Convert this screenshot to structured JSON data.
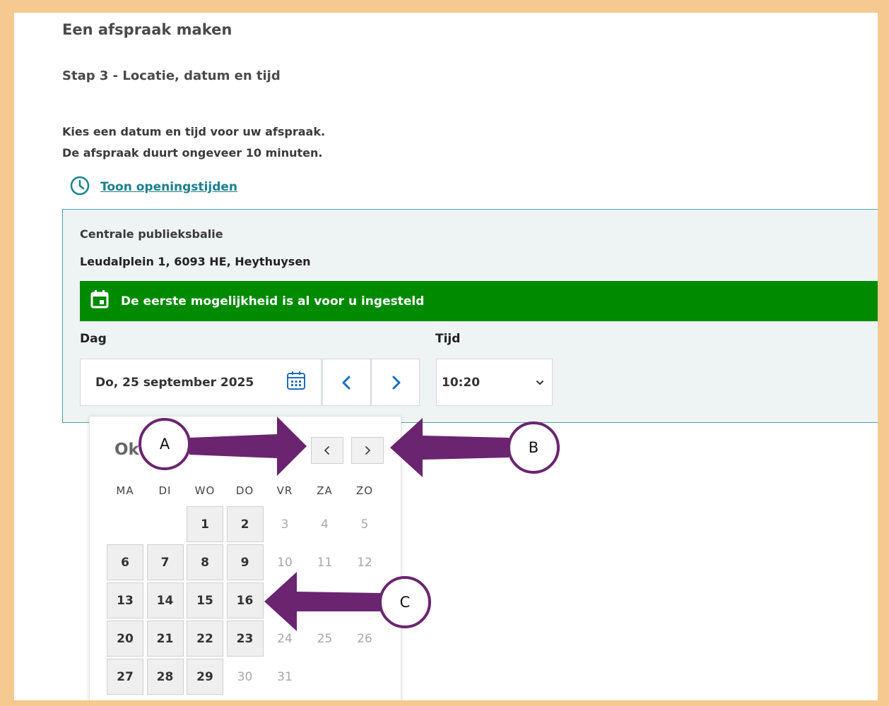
{
  "page": {
    "title": "Een afspraak maken",
    "step": "Stap 3 - Locatie, datum en tijd",
    "intro_line1": "Kies een datum en tijd voor uw afspraak.",
    "intro_line2": "De afspraak duurt ongeveer 10 minuten.",
    "hours_link": "Toon openingstijden"
  },
  "location": {
    "name": "Centrale publieksbalie",
    "address": "Leudalplein 1, 6093 HE, Heythuysen",
    "banner": "De eerste mogelijkheid is al voor u ingesteld"
  },
  "form": {
    "day_label": "Dag",
    "time_label": "Tijd",
    "date_value": "Do, 25 september 2025",
    "time_value": "10:20"
  },
  "calendar": {
    "month_title": "Ok        2",
    "weekdays": [
      "MA",
      "DI",
      "WO",
      "DO",
      "VR",
      "ZA",
      "ZO"
    ],
    "leading_blanks": 2,
    "days": [
      {
        "d": "1",
        "a": true
      },
      {
        "d": "2",
        "a": true
      },
      {
        "d": "3",
        "a": false
      },
      {
        "d": "4",
        "a": false
      },
      {
        "d": "5",
        "a": false
      },
      {
        "d": "6",
        "a": true
      },
      {
        "d": "7",
        "a": true
      },
      {
        "d": "8",
        "a": true
      },
      {
        "d": "9",
        "a": true
      },
      {
        "d": "10",
        "a": false
      },
      {
        "d": "11",
        "a": false
      },
      {
        "d": "12",
        "a": false
      },
      {
        "d": "13",
        "a": true
      },
      {
        "d": "14",
        "a": true
      },
      {
        "d": "15",
        "a": true
      },
      {
        "d": "16",
        "a": true
      },
      {
        "d": "17",
        "a": false
      },
      {
        "d": "18",
        "a": false
      },
      {
        "d": "19",
        "a": false
      },
      {
        "d": "20",
        "a": true
      },
      {
        "d": "21",
        "a": true
      },
      {
        "d": "22",
        "a": true
      },
      {
        "d": "23",
        "a": true
      },
      {
        "d": "24",
        "a": false
      },
      {
        "d": "25",
        "a": false
      },
      {
        "d": "26",
        "a": false
      },
      {
        "d": "27",
        "a": true
      },
      {
        "d": "28",
        "a": true
      },
      {
        "d": "29",
        "a": true
      },
      {
        "d": "30",
        "a": false
      },
      {
        "d": "31",
        "a": false
      }
    ]
  },
  "annotations": {
    "a": "A",
    "b": "B",
    "c": "C",
    "arrow_color": "#6b2470"
  },
  "colors": {
    "teal": "#1b7f8e",
    "banner_green": "#008a00",
    "frame": "#f5c990"
  }
}
